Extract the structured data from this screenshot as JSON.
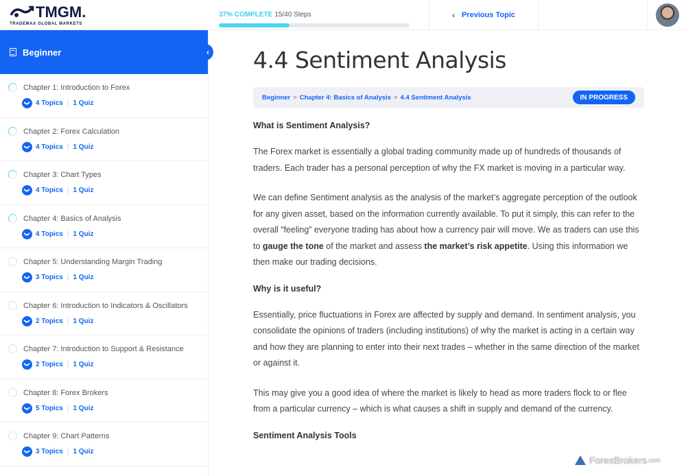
{
  "brand": {
    "name": "TMGM.",
    "tagline": "TRADEMAX GLOBAL MARKETS"
  },
  "progress": {
    "label": "37% COMPLETE",
    "steps": "15/40 Steps",
    "percent": 37
  },
  "nav": {
    "previous_label": "Previous Topic"
  },
  "sidebar": {
    "title": "Beginner",
    "chapters": [
      {
        "title": "Chapter 1: Introduction to Forex",
        "topics": "4 Topics",
        "quiz": "1 Quiz",
        "status": "in-progress"
      },
      {
        "title": "Chapter 2: Forex Calculation",
        "topics": "4 Topics",
        "quiz": "1 Quiz",
        "status": "in-progress"
      },
      {
        "title": "Chapter 3: Chart Types",
        "topics": "4 Topics",
        "quiz": "1 Quiz",
        "status": "in-progress"
      },
      {
        "title": "Chapter 4: Basics of Analysis",
        "topics": "4 Topics",
        "quiz": "1 Quiz",
        "status": "in-progress"
      },
      {
        "title": "Chapter 5: Understanding Margin Trading",
        "topics": "3 Topics",
        "quiz": "1 Quiz",
        "status": "not-started"
      },
      {
        "title": "Chapter 6: Introduction to Indicators & Oscillators",
        "topics": "2 Topics",
        "quiz": "1 Quiz",
        "status": "not-started"
      },
      {
        "title": "Chapter 7: Introduction to Support & Resistance",
        "topics": "2 Topics",
        "quiz": "1 Quiz",
        "status": "not-started"
      },
      {
        "title": "Chapter 8: Forex Brokers",
        "topics": "5 Topics",
        "quiz": "1 Quiz",
        "status": "not-started"
      },
      {
        "title": "Chapter 9: Chart Patterns",
        "topics": "3 Topics",
        "quiz": "1 Quiz",
        "status": "not-started"
      }
    ]
  },
  "main": {
    "title": "4.4 Sentiment Analysis",
    "breadcrumb": [
      "Beginner",
      "Chapter 4: Basics of Analysis",
      "4.4 Sentiment Analysis"
    ],
    "breadcrumb_sep": ">",
    "status": "IN PROGRESS",
    "h_what": "What is Sentiment Analysis?",
    "p1": "The Forex market is essentially a global trading community made up of hundreds of thousands of traders. Each trader has a personal perception of why the FX market is moving in a particular way.",
    "p2_a": "We can define Sentiment analysis as the analysis of the market’s aggregate perception of the outlook for any given asset, based on the information currently available. To put it simply, this can refer to the overall “feeling” everyone trading has about how a currency pair will move. We as traders can use this to ",
    "p2_b1": "gauge the tone",
    "p2_c": " of the market and assess ",
    "p2_b2": "the market’s risk appetite",
    "p2_d": ". Using this information we then make our trading decisions.",
    "h_why": "Why is it useful?",
    "p3": "Essentially, price fluctuations in Forex are affected by supply and demand. In sentiment analysis, you consolidate the opinions of traders (including institutions) of why the market is acting in a certain way and how they are planning to enter into their next trades – whether in the same direction of the market or against it.",
    "p4": "This may give you a good idea of where the market is likely to head as more traders flock to or flee from a particular currency – which is what causes a shift in supply and demand of the currency.",
    "h_tools": "Sentiment Analysis Tools"
  },
  "watermark": {
    "name": "ForexBrokers",
    "suffix": ".com"
  }
}
